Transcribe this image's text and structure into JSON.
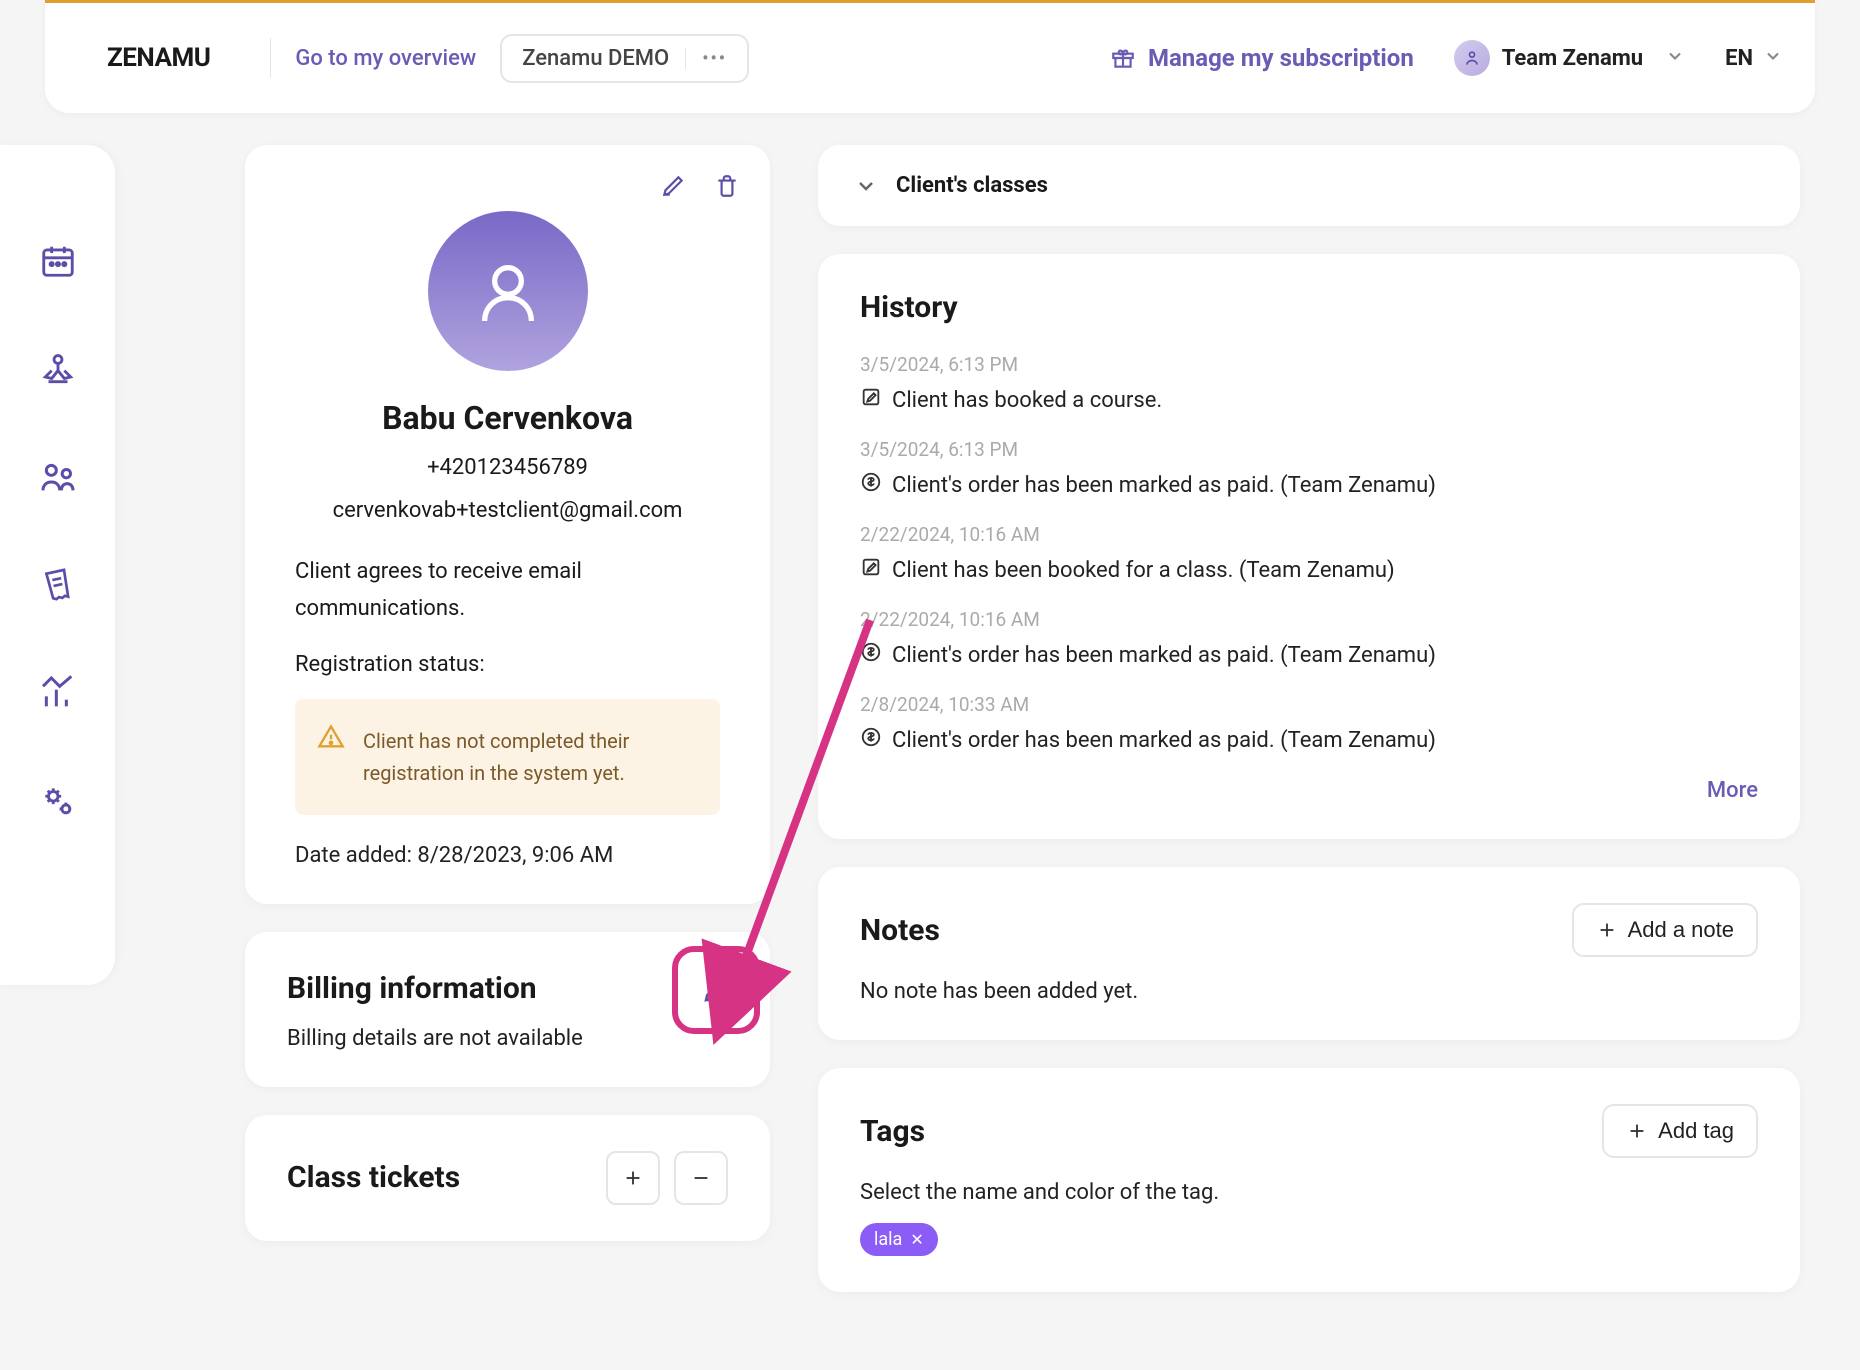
{
  "topbar": {
    "logo_text": "ZENAMU",
    "overview_link": "Go to my overview",
    "demo_label": "Zenamu DEMO",
    "subscription_label": "Manage my subscription",
    "team_label": "Team Zenamu",
    "language": "EN"
  },
  "client": {
    "name": "Babu Cervenkova",
    "phone": "+420123456789",
    "email": "cervenkovab+testclient@gmail.com",
    "consent_text": "Client agrees to receive email communications.",
    "status_label": "Registration status:",
    "warning_text": "Client has not completed their registration in the system yet.",
    "date_added": "Date added: 8/28/2023, 9:06 AM"
  },
  "billing": {
    "title": "Billing information",
    "empty_text": "Billing details are not available"
  },
  "tickets": {
    "title": "Class tickets"
  },
  "client_classes": {
    "title": "Client's classes"
  },
  "history": {
    "title": "History",
    "more_label": "More",
    "items": [
      {
        "time": "3/5/2024, 6:13 PM",
        "icon": "edit",
        "text": "Client has booked a course."
      },
      {
        "time": "3/5/2024, 6:13 PM",
        "icon": "dollar",
        "text": "Client's order has been marked as paid. (Team Zenamu)"
      },
      {
        "time": "2/22/2024, 10:16 AM",
        "icon": "edit",
        "text": "Client has been booked for a class. (Team Zenamu)"
      },
      {
        "time": "2/22/2024, 10:16 AM",
        "icon": "dollar",
        "text": "Client's order has been marked as paid. (Team Zenamu)"
      },
      {
        "time": "2/8/2024, 10:33 AM",
        "icon": "dollar",
        "text": "Client's order has been marked as paid. (Team Zenamu)"
      }
    ]
  },
  "notes": {
    "title": "Notes",
    "add_label": "Add a note",
    "empty_text": "No note has been added yet."
  },
  "tags": {
    "title": "Tags",
    "add_label": "Add tag",
    "hint": "Select the name and color of the tag.",
    "list": [
      {
        "label": "lala"
      }
    ]
  }
}
